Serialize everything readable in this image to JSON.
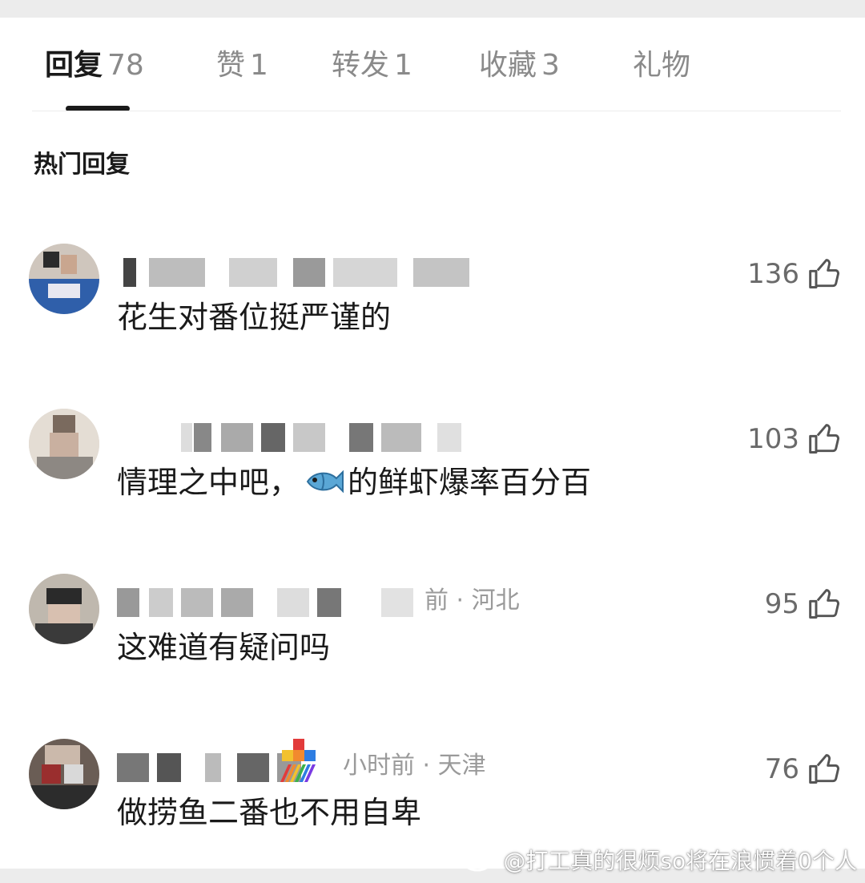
{
  "tabs": [
    {
      "label": "回复",
      "count": "78"
    },
    {
      "label": "赞",
      "count": "1"
    },
    {
      "label": "转发",
      "count": "1"
    },
    {
      "label": "收藏",
      "count": "3"
    },
    {
      "label": "礼物",
      "count": ""
    }
  ],
  "section_title": "热门回复",
  "comments": [
    {
      "meta_tail": "",
      "text": "花生对番位挺严谨的",
      "likes": "136"
    },
    {
      "meta_tail": "",
      "text_before": "情理之中吧，",
      "text_after": "的鲜虾爆率百分百",
      "likes": "103"
    },
    {
      "meta_tail": "前 · 河北",
      "text": "这难道有疑问吗",
      "likes": "95"
    },
    {
      "meta_tail": "小时前 · 天津",
      "text": "做捞鱼二番也不用自卑",
      "likes": "76"
    }
  ],
  "watermark": "@打工真的很烦so将在浪惯着0个人",
  "colors": {
    "background": "#ececec",
    "card": "#ffffff",
    "text": "#1a1a1a",
    "muted": "#9a9a9a"
  }
}
